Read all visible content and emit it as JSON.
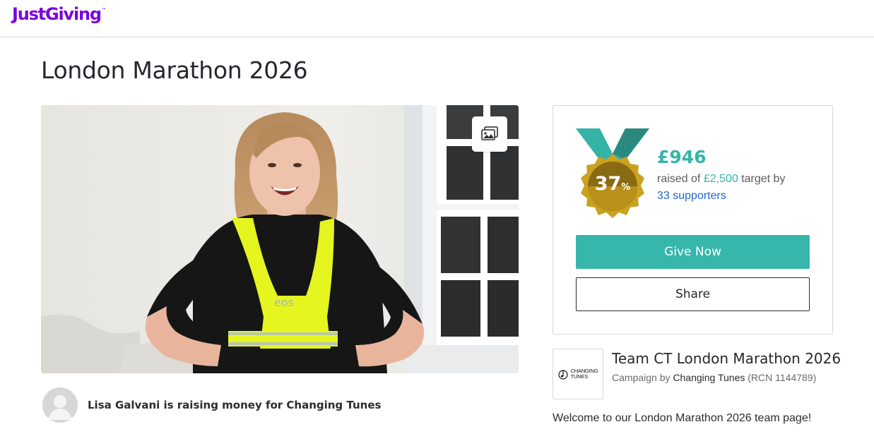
{
  "header": {
    "logo_text": "JustGiving",
    "logo_tm": "™",
    "brand_color": "#7a04dd"
  },
  "page": {
    "title": "London Marathon 2026"
  },
  "photo": {
    "gallery_button_icon": "gallery-icon"
  },
  "fundraiser": {
    "text": "Lisa Galvani is raising money for Changing Tunes",
    "avatar_icon": "avatar-placeholder-icon"
  },
  "donation_card": {
    "medal_percent": "37",
    "medal_percent_sign": "%",
    "amount_raised": "£946",
    "raised_prefix": "raised of ",
    "target": "£2,500",
    "raised_suffix": " target by",
    "supporters": "33 supporters",
    "give_button": "Give Now",
    "share_button": "Share",
    "progress_fraction": 0.37,
    "accent_color": "#37b6ab"
  },
  "team": {
    "logo_line1": "CHANGING",
    "logo_line2": "TUNES",
    "title": "Team CT London Marathon 2026",
    "campaign_prefix": "Campaign by ",
    "charity": "Changing Tunes",
    "rcn": " (RCN 1144789)"
  },
  "description": {
    "welcome": "Welcome to our London Marathon 2026 team page!"
  }
}
